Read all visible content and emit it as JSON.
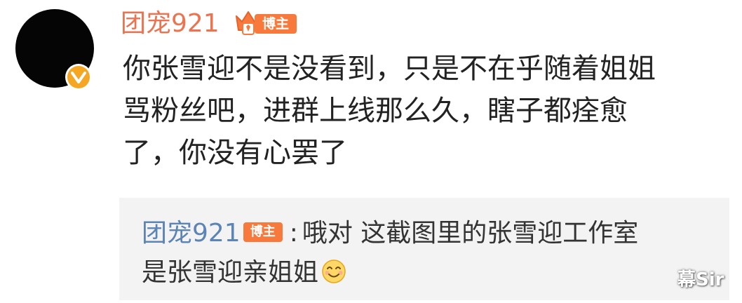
{
  "comment": {
    "username": "团宠921",
    "badge_label": "博主",
    "lines": [
      "你张雪迎不是没看到，只是不在乎随着姐姐",
      "骂粉丝吧，进群上线那么久，瞎子都痊愈",
      "了，你没有心罢了"
    ]
  },
  "reply": {
    "username": "团宠921",
    "badge_label": "博主",
    "separator": ":",
    "line1_text": "哦对 这截图里的张雪迎工作室",
    "line2_text": "是张雪迎亲姐姐"
  },
  "watermark": {
    "text": "幕Sir"
  },
  "colors": {
    "username": "#eb7350",
    "reply_username": "#5c84b5",
    "badge": "#f7793c",
    "verified": "#f5a623",
    "reply_background": "#f3f3f3"
  },
  "icons": {
    "verified": "verified-v-icon",
    "crown": "crown-icon",
    "emoji": "smile-emoji-icon"
  }
}
